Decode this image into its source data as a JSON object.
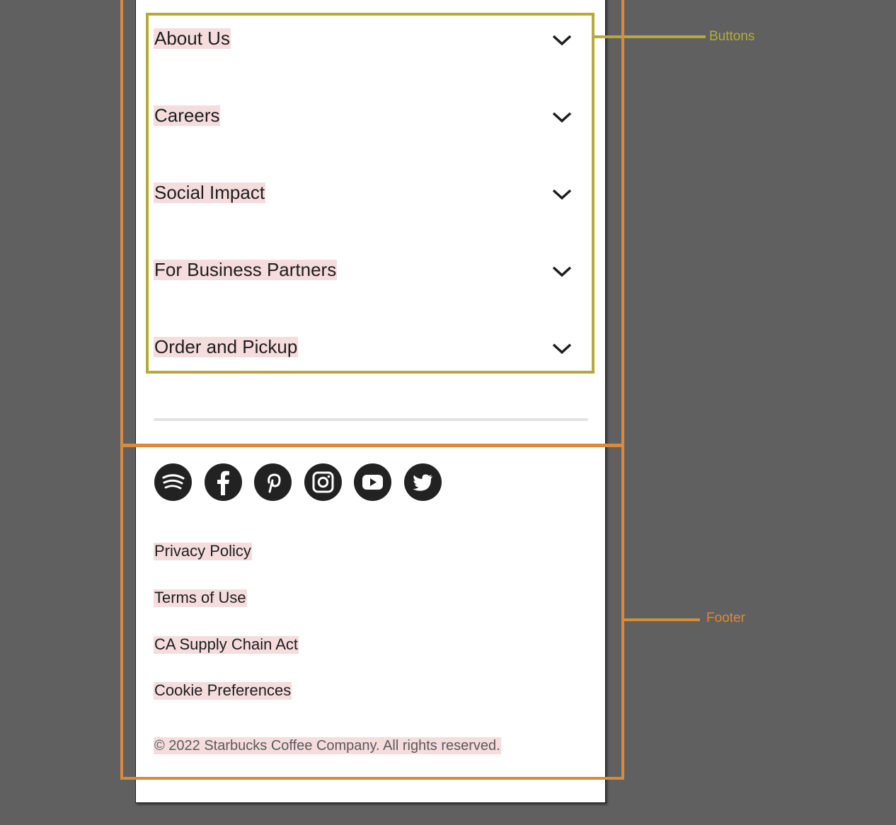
{
  "annotations": {
    "buttons_label": "Buttons",
    "footer_label": "Footer",
    "buttons_color": "#b6ab38",
    "footer_color": "#d98a3a"
  },
  "menu": {
    "items": [
      {
        "label": "About Us",
        "icon": "chevron-down-icon"
      },
      {
        "label": "Careers",
        "icon": "chevron-down-icon"
      },
      {
        "label": "Social Impact",
        "icon": "chevron-down-icon"
      },
      {
        "label": "For Business Partners",
        "icon": "chevron-down-icon"
      },
      {
        "label": "Order and Pickup",
        "icon": "chevron-down-icon"
      }
    ]
  },
  "footer": {
    "social_icons": [
      "spotify-icon",
      "facebook-icon",
      "pinterest-icon",
      "instagram-icon",
      "youtube-icon",
      "twitter-icon"
    ],
    "links": [
      "Privacy Policy",
      "Terms of Use",
      "CA Supply Chain Act",
      "Cookie Preferences"
    ],
    "copyright": "© 2022 Starbucks Coffee Company. All rights reserved."
  },
  "colors": {
    "background": "#606060",
    "highlight": "#f5dcdd",
    "icon_fill": "#222222"
  }
}
